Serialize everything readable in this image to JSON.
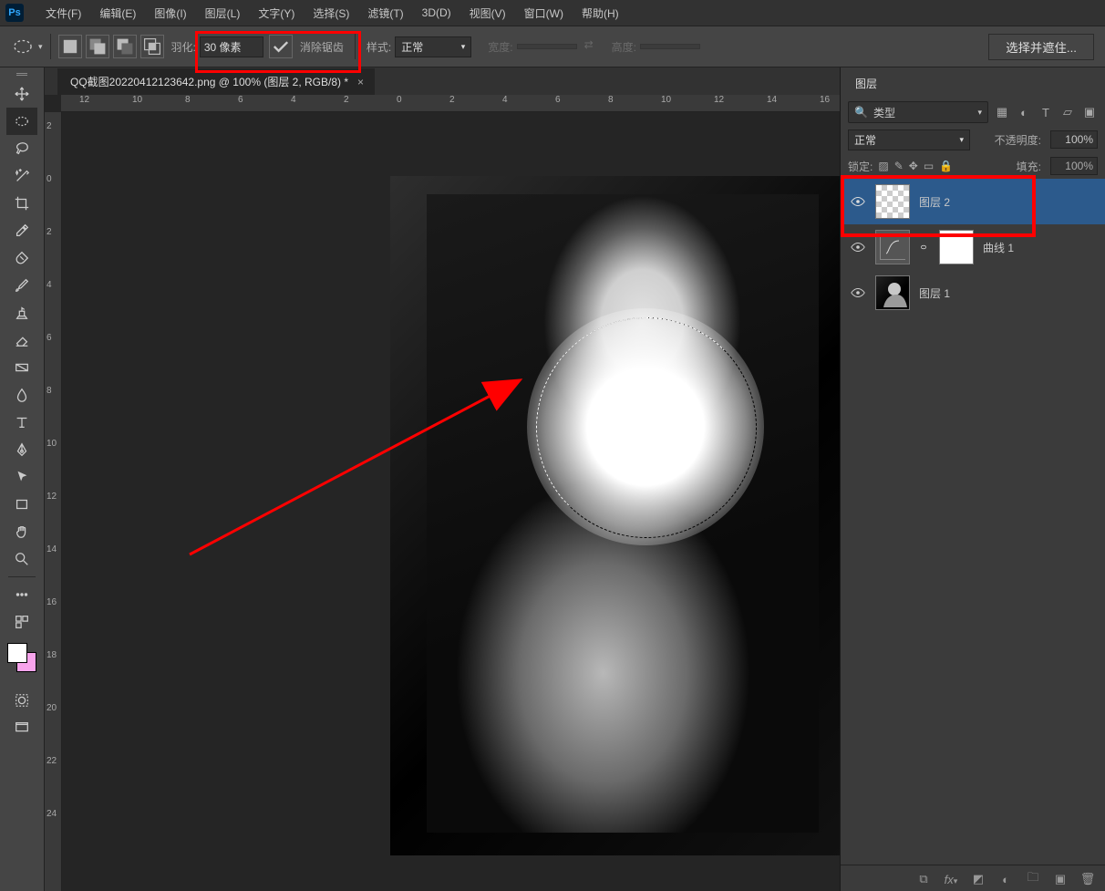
{
  "menubar": {
    "items": [
      "文件(F)",
      "编辑(E)",
      "图像(I)",
      "图层(L)",
      "文字(Y)",
      "选择(S)",
      "滤镜(T)",
      "3D(D)",
      "视图(V)",
      "窗口(W)",
      "帮助(H)"
    ]
  },
  "optionsBar": {
    "featherLabel": "羽化:",
    "featherValue": "30 像素",
    "antialiasLabel": "消除锯齿",
    "styleLabel": "样式:",
    "styleValue": "正常",
    "widthLabel": "宽度:",
    "heightLabel": "高度:",
    "selectAndMask": "选择并遮住..."
  },
  "document": {
    "tabTitle": "QQ截图20220412123642.png @ 100% (图层 2, RGB/8) *",
    "rulerTopTicks": [
      "12",
      "10",
      "8",
      "6",
      "4",
      "2",
      "0",
      "2",
      "4",
      "6",
      "8",
      "10",
      "12",
      "14",
      "16"
    ],
    "rulerLeftTicks": [
      "2",
      "0",
      "2",
      "4",
      "6",
      "8",
      "10",
      "12",
      "14",
      "16",
      "18",
      "20",
      "22",
      "24"
    ]
  },
  "layersPanel": {
    "tabLabel": "图层",
    "filterLabel": "类型",
    "blendMode": "正常",
    "opacityLabel": "不透明度:",
    "opacityValue": "100%",
    "lockLabel": "锁定:",
    "fillLabel": "填充:",
    "fillValue": "100%",
    "layers": [
      {
        "name": "图层 2",
        "type": "pixel",
        "selected": true
      },
      {
        "name": "曲线 1",
        "type": "adjustment",
        "selected": false
      },
      {
        "name": "图层 1",
        "type": "pixel",
        "selected": false
      }
    ]
  },
  "tools": {
    "list": [
      "move",
      "rect-marquee",
      "ellipse-marquee",
      "lasso",
      "magic-wand",
      "crop",
      "eyedropper",
      "healing",
      "brush",
      "clone",
      "eraser",
      "gradient",
      "blur",
      "type",
      "pen",
      "path-select",
      "rectangle",
      "hand",
      "zoom"
    ]
  }
}
